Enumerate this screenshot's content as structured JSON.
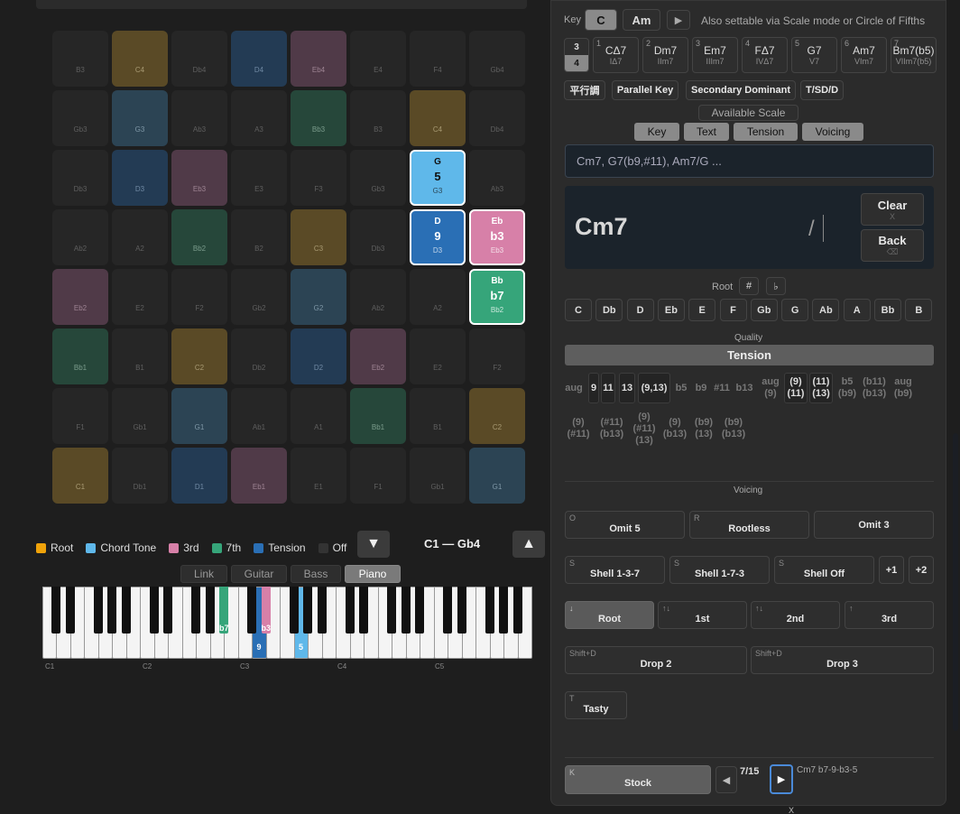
{
  "grid": {
    "rows": [
      [
        {
          "n": "B3",
          "s": ""
        },
        {
          "n": "C4",
          "s": "root"
        },
        {
          "n": "Db4",
          "s": ""
        },
        {
          "n": "D4",
          "s": "tension"
        },
        {
          "n": "Eb4",
          "s": "third"
        },
        {
          "n": "E4",
          "s": ""
        },
        {
          "n": "F4",
          "s": ""
        },
        {
          "n": "Gb4",
          "s": ""
        }
      ],
      [
        {
          "n": "Gb3",
          "s": ""
        },
        {
          "n": "G3",
          "s": "tone"
        },
        {
          "n": "Ab3",
          "s": ""
        },
        {
          "n": "A3",
          "s": ""
        },
        {
          "n": "Bb3",
          "s": "seventh"
        },
        {
          "n": "B3",
          "s": ""
        },
        {
          "n": "C4",
          "s": "root"
        },
        {
          "n": "Db4",
          "s": ""
        }
      ],
      [
        {
          "n": "Db3",
          "s": ""
        },
        {
          "n": "D3",
          "s": "tension"
        },
        {
          "n": "Eb3",
          "s": "third"
        },
        {
          "n": "E3",
          "s": ""
        },
        {
          "n": "F3",
          "s": ""
        },
        {
          "n": "Gb3",
          "s": ""
        },
        {
          "n": "G3",
          "s": "a-tone",
          "lbl": "G",
          "deg": "5"
        },
        {
          "n": "Ab3",
          "s": ""
        }
      ],
      [
        {
          "n": "Ab2",
          "s": ""
        },
        {
          "n": "A2",
          "s": ""
        },
        {
          "n": "Bb2",
          "s": "seventh"
        },
        {
          "n": "B2",
          "s": ""
        },
        {
          "n": "C3",
          "s": "root"
        },
        {
          "n": "Db3",
          "s": ""
        },
        {
          "n": "D3",
          "s": "a-tension",
          "lbl": "D",
          "deg": "9"
        },
        {
          "n": "Eb3",
          "s": "a-third",
          "lbl": "Eb",
          "deg": "b3"
        }
      ],
      [
        {
          "n": "Eb2",
          "s": "third"
        },
        {
          "n": "E2",
          "s": ""
        },
        {
          "n": "F2",
          "s": ""
        },
        {
          "n": "Gb2",
          "s": ""
        },
        {
          "n": "G2",
          "s": "tone"
        },
        {
          "n": "Ab2",
          "s": ""
        },
        {
          "n": "A2",
          "s": ""
        },
        {
          "n": "Bb2",
          "s": "a-seventh",
          "lbl": "Bb",
          "deg": "b7"
        }
      ],
      [
        {
          "n": "Bb1",
          "s": "seventh"
        },
        {
          "n": "B1",
          "s": ""
        },
        {
          "n": "C2",
          "s": "root"
        },
        {
          "n": "Db2",
          "s": ""
        },
        {
          "n": "D2",
          "s": "tension"
        },
        {
          "n": "Eb2",
          "s": "third"
        },
        {
          "n": "E2",
          "s": ""
        },
        {
          "n": "F2",
          "s": ""
        }
      ],
      [
        {
          "n": "F1",
          "s": ""
        },
        {
          "n": "Gb1",
          "s": ""
        },
        {
          "n": "G1",
          "s": "tone"
        },
        {
          "n": "Ab1",
          "s": ""
        },
        {
          "n": "A1",
          "s": ""
        },
        {
          "n": "Bb1",
          "s": "seventh"
        },
        {
          "n": "B1",
          "s": ""
        },
        {
          "n": "C2",
          "s": "root"
        }
      ],
      [
        {
          "n": "C1",
          "s": "root"
        },
        {
          "n": "Db1",
          "s": ""
        },
        {
          "n": "D1",
          "s": "tension"
        },
        {
          "n": "Eb1",
          "s": "third"
        },
        {
          "n": "E1",
          "s": ""
        },
        {
          "n": "F1",
          "s": ""
        },
        {
          "n": "Gb1",
          "s": ""
        },
        {
          "n": "G1",
          "s": "tone"
        }
      ]
    ]
  },
  "legend": {
    "items": [
      {
        "label": "Root",
        "color": "#f0a30a"
      },
      {
        "label": "Chord Tone",
        "color": "#5fb8ea"
      },
      {
        "label": "3rd",
        "color": "#d780a8"
      },
      {
        "label": "7th",
        "color": "#36a57a"
      },
      {
        "label": "Tension",
        "color": "#2a6fb5"
      },
      {
        "label": "Off",
        "color": "#333333"
      }
    ],
    "down_icon": "▼",
    "up_icon": "▲",
    "range": "C1 — Gb4"
  },
  "view_tabs": [
    "Link",
    "Guitar",
    "Bass",
    "Piano"
  ],
  "view_tab_selected": "Piano",
  "piano": {
    "octave_labels": [
      "C1",
      "C2",
      "C3",
      "C4",
      "C5"
    ],
    "marks": {
      "b7": "b7",
      "b3": "b3",
      "n9": "9",
      "n5": "5"
    }
  },
  "key": {
    "label": "Key",
    "major": "C",
    "minor": "Am",
    "play_icon": "▶",
    "hint": "Also settable via Scale mode or Circle of Fifths"
  },
  "seventh_toggle": {
    "top": "3",
    "bottom": "4"
  },
  "diatonic": [
    {
      "num": "1",
      "chord": "CΔ7",
      "roman": "IΔ7"
    },
    {
      "num": "2",
      "chord": "Dm7",
      "roman": "IIm7"
    },
    {
      "num": "3",
      "chord": "Em7",
      "roman": "IIIm7"
    },
    {
      "num": "4",
      "chord": "FΔ7",
      "roman": "IVΔ7"
    },
    {
      "num": "5",
      "chord": "G7",
      "roman": "V7"
    },
    {
      "num": "6",
      "chord": "Am7",
      "roman": "VIm7"
    },
    {
      "num": "7",
      "chord": "Bm7(b5)",
      "roman": "VIIm7(b5)"
    }
  ],
  "relation_buttons": [
    "平行調",
    "Parallel Key",
    "Secondary Dominant",
    "T/SD/D"
  ],
  "available_scale": "Available Scale",
  "display_tabs": [
    "Key",
    "Text",
    "Tension",
    "Voicing"
  ],
  "text_input": {
    "placeholder": "Cm7, G7(b9,#11), Am7/G ..."
  },
  "display": {
    "chord": "Cm7",
    "slash": "/"
  },
  "clear": {
    "label": "Clear",
    "hotkey": "X"
  },
  "back": {
    "label": "Back",
    "hotkey": "⌫"
  },
  "root": {
    "label": "Root",
    "sharp": "#",
    "flat": "♭",
    "notes": [
      "C",
      "Db",
      "D",
      "Eb",
      "E",
      "F",
      "Gb",
      "G",
      "Ab",
      "A",
      "Bb",
      "B"
    ]
  },
  "quality": {
    "label": "Quality",
    "value": "Tension"
  },
  "tensions_row1": [
    {
      "t": "aug",
      "on": false
    },
    {
      "t": "9",
      "on": true
    },
    {
      "t": "11",
      "on": true
    },
    {
      "t": "13",
      "on": true
    },
    {
      "t": "(9,13)",
      "on": true
    },
    {
      "t": "b5",
      "on": false
    },
    {
      "t": "b9",
      "on": false
    },
    {
      "t": "#11",
      "on": false
    },
    {
      "t": "b13",
      "on": false
    },
    {
      "t": "aug (9)",
      "on": false
    },
    {
      "t": "(9) (11)",
      "on": true
    },
    {
      "t": "(11) (13)",
      "on": true
    },
    {
      "t": "b5 (b9)",
      "on": false
    },
    {
      "t": "(b11) (b13)",
      "on": false
    },
    {
      "t": "aug (b9)",
      "on": false
    }
  ],
  "tensions_row2": [
    {
      "t": "(9) (#11)",
      "on": false
    },
    {
      "t": "(#11) (b13)",
      "on": false
    },
    {
      "t": "(9) (#11) (13)",
      "on": false
    },
    {
      "t": "(9) (b13)",
      "on": false
    },
    {
      "t": "(b9) (13)",
      "on": false
    },
    {
      "t": "(b9) (b13)",
      "on": false
    }
  ],
  "voicing": {
    "label": "Voicing",
    "omit5": {
      "hk": "O",
      "label": "Omit 5"
    },
    "rootless": {
      "hk": "R",
      "label": "Rootless"
    },
    "omit3": {
      "label": "Omit 3"
    },
    "shell137": {
      "hk": "S",
      "label": "Shell 1-3-7"
    },
    "shell173": {
      "hk": "S",
      "label": "Shell 1-7-3"
    },
    "shelloff": {
      "hk": "S",
      "label": "Shell Off"
    },
    "plus1": "+1",
    "plus2": "+2",
    "inv_root": {
      "hk": "↓",
      "label": "Root"
    },
    "inv_1st": {
      "hk": "↑↓",
      "label": "1st"
    },
    "inv_2nd": {
      "hk": "↑↓",
      "label": "2nd"
    },
    "inv_3rd": {
      "hk": "↑",
      "label": "3rd"
    },
    "drop2": {
      "hk": "Shift+D",
      "label": "Drop 2"
    },
    "drop3": {
      "hk": "Shift+D",
      "label": "Drop 3"
    },
    "tasty": {
      "hk": "T",
      "label": "Tasty"
    }
  },
  "stock": {
    "hk": "K",
    "label": "Stock",
    "prev_icon": "◀",
    "next_icon": "▶",
    "count": "7/15",
    "name": "Cm7 b7-9-b3-5",
    "close": "X"
  }
}
